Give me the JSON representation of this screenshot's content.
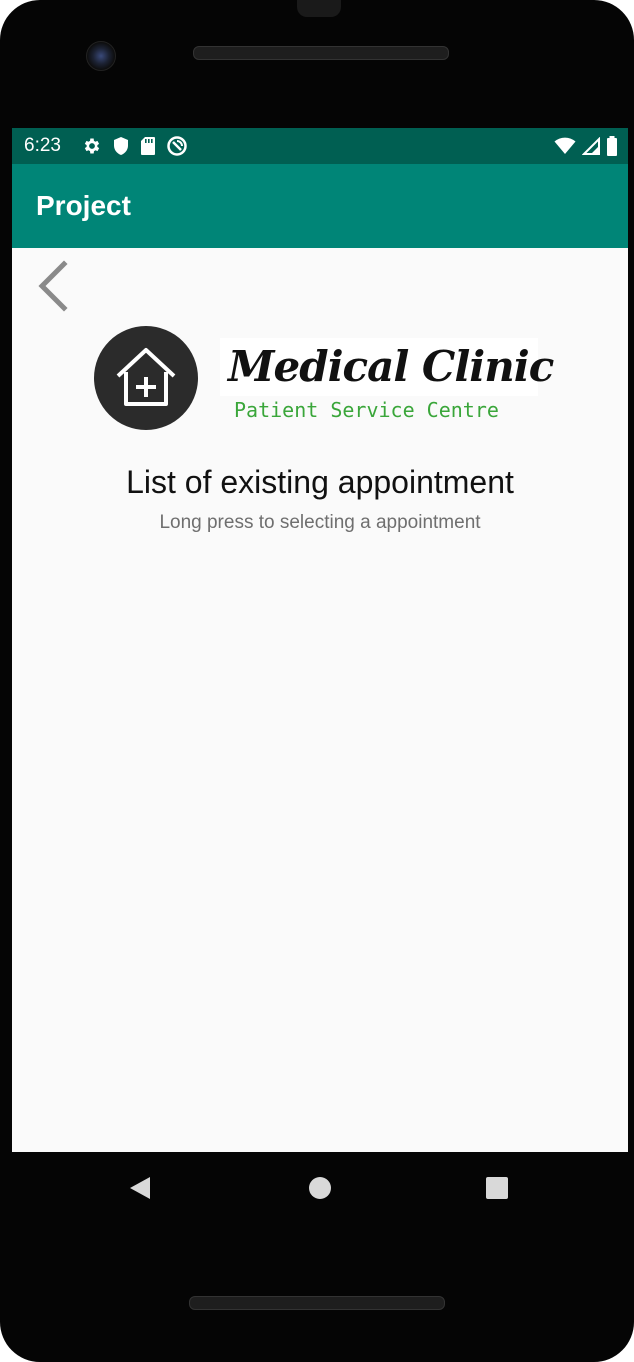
{
  "status_bar": {
    "time": "6:23",
    "left_icons": [
      "settings-icon",
      "shield-icon",
      "sd-card-icon",
      "data-saver-icon"
    ],
    "right_icons": [
      "wifi-icon",
      "cell-signal-icon",
      "battery-icon"
    ],
    "background": "#005f52"
  },
  "app_bar": {
    "title": "Project",
    "color": "#008577"
  },
  "header": {
    "back_icon": "chevron-left-icon",
    "logo_icon": "house-plus-icon",
    "brand_name": "Medical Clinic",
    "brand_tagline": "Patient Service Centre",
    "tagline_color": "#3aa63a"
  },
  "content": {
    "title": "List of existing appointment",
    "subtitle": "Long press to selecting a appointment",
    "appointments": []
  },
  "nav_bar": {
    "buttons": [
      "back-triangle-icon",
      "home-circle-icon",
      "recents-square-icon"
    ]
  }
}
